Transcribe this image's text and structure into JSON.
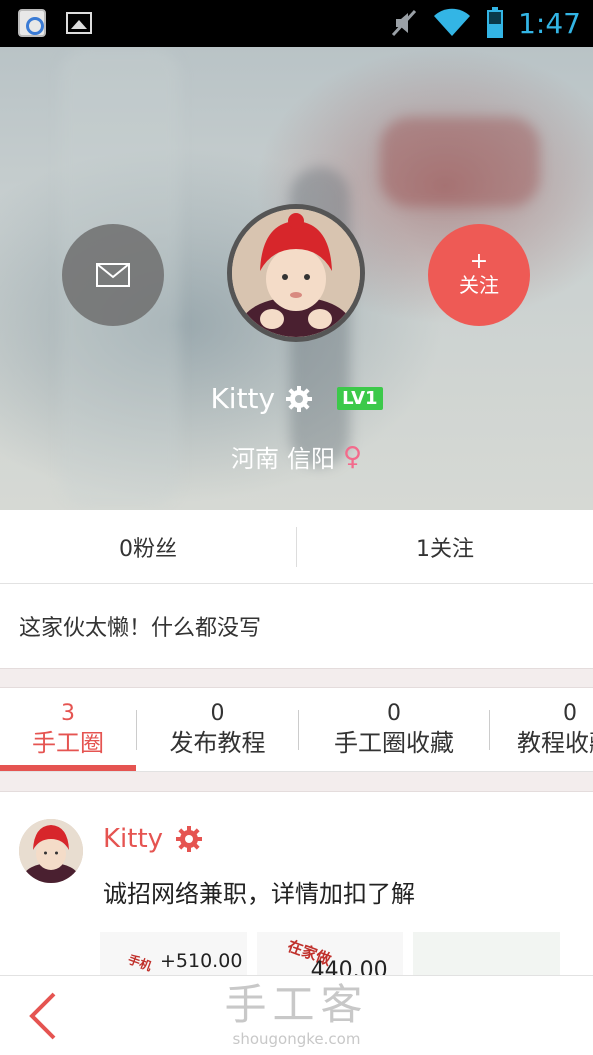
{
  "status_bar": {
    "time": "1:47"
  },
  "profile": {
    "follow_label": "关注",
    "follow_plus": "+",
    "name": "Kitty",
    "level": "LV1",
    "province": "河南",
    "city": "信阳",
    "gender_symbol": "♀"
  },
  "stats": {
    "fans": "0粉丝",
    "following": "1关注"
  },
  "bio": "这家伙太懒！什么都没写",
  "tabs": [
    {
      "count": "3",
      "label": "手工圈"
    },
    {
      "count": "0",
      "label": "发布教程"
    },
    {
      "count": "0",
      "label": "手工圈收藏"
    },
    {
      "count": "0",
      "label": "教程收藏"
    }
  ],
  "post": {
    "author": "Kitty",
    "text": "诚招网络兼职，详情加扣了解",
    "thumbs": [
      {
        "amount": "+510.00",
        "stamp": "手机"
      },
      {
        "amount": "440.00",
        "stamp": "在家做"
      },
      {
        "amount": "",
        "stamp": ""
      }
    ]
  },
  "bottom_bar": {
    "brand": "手工客",
    "url": "shougongke.com"
  },
  "colors": {
    "accent": "#e55451",
    "follow": "#ee5a55",
    "level_badge": "#3cc94a",
    "status_icons": "#33b5e5"
  }
}
